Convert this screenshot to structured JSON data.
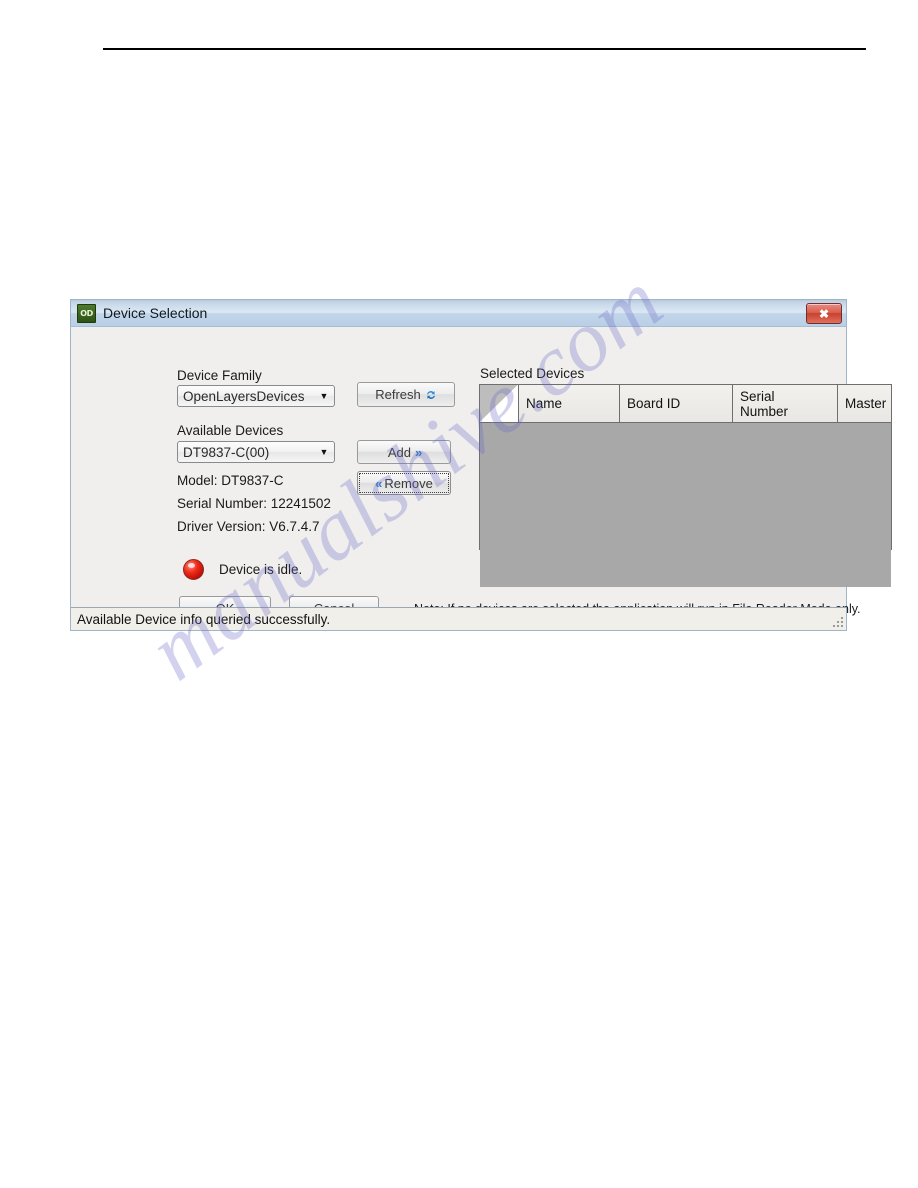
{
  "watermark": {
    "text": "manualshive.com"
  },
  "dialog": {
    "title": "Device Selection",
    "icon_name": "device-app-icon",
    "icon_glyph": "OD",
    "close_label": "✖",
    "device_family": {
      "label": "Device Family",
      "value": "OpenLayersDevices",
      "arrow": "▼"
    },
    "refresh_button": {
      "label": "Refresh"
    },
    "available_devices": {
      "label": "Available Devices",
      "value": "DT9837-C(00)",
      "arrow": "▼"
    },
    "add_button": {
      "label": "Add",
      "chevron": "»"
    },
    "remove_button": {
      "label": "Remove",
      "chevron": "«"
    },
    "info": {
      "model": "Model: DT9837-C",
      "serial_number": "Serial Number: 12241502",
      "driver_version": "Driver Version: V6.7.4.7"
    },
    "status_indicator": {
      "text": "Device is idle.",
      "color": "#e02a18"
    },
    "ok_button": {
      "label": "OK"
    },
    "cancel_button": {
      "label": "Cancel"
    },
    "note": "Note: If no devices are selected the application will run in File Reader Mode only.",
    "selected_devices": {
      "label": "Selected Devices",
      "columns": [
        "",
        "Name",
        "Board ID",
        "Serial\nNumber",
        "Master"
      ],
      "column_labels": {
        "corner": "",
        "name": "Name",
        "board_id": "Board ID",
        "serial_number_line1": "Serial",
        "serial_number_line2": "Number",
        "master": "Master"
      },
      "rows": []
    },
    "statusbar": {
      "text": "Available Device info queried successfully."
    }
  }
}
